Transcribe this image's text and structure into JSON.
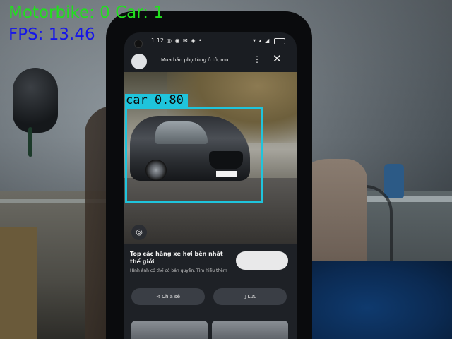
{
  "overlay": {
    "counts_text": "Motorbike: 0 Car: 1",
    "fps_text": "FPS: 13.46",
    "counts_color": "#21e01e",
    "fps_color": "#1515ea"
  },
  "detection": {
    "label_text": "car 0.80",
    "class": "car",
    "confidence": 0.8,
    "box_color": "#1fc4dc"
  },
  "phone_screen": {
    "status_time": "1:12",
    "header_title": "Mua bán phụ tùng ô tô, mu...",
    "more_icon": "more-vertical-icon",
    "close_icon": "close-icon",
    "card_title": "Top các hãng xe hơi bền nhất thế giới",
    "card_subtitle": "Hình ảnh có thể có bản quyền. Tìm hiểu thêm",
    "share_label": "Chia sẻ",
    "save_label": "Lưu"
  }
}
